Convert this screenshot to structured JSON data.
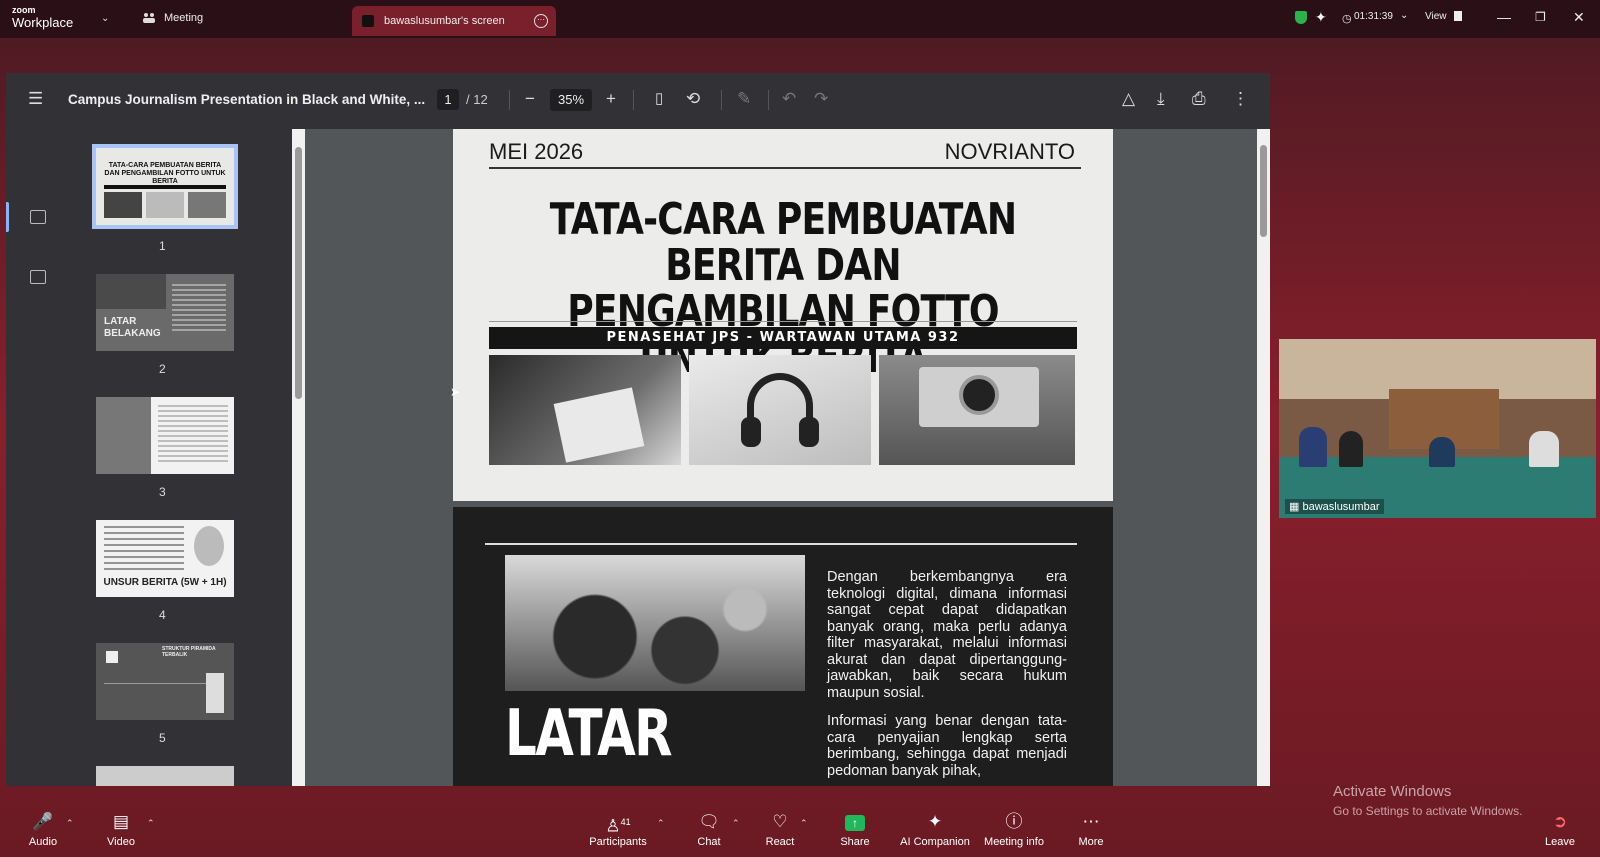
{
  "app": {
    "brand_top": "zoom",
    "brand_bottom": "Workplace"
  },
  "tabs": [
    {
      "label": "Meeting"
    },
    {
      "label": "bawaslusumbar's screen"
    }
  ],
  "topright": {
    "timer": "01:31:39",
    "view_label": "View"
  },
  "pdf": {
    "title": "Campus Journalism Presentation in Black and White, ...",
    "current_page": "1",
    "total_pages": "/ 12",
    "zoom": "35%"
  },
  "thumbnails": [
    {
      "num": "1",
      "title": "TATA-CARA PEMBUATAN BERITA DAN PENGAMBILAN FOTTO UNTUK BERITA"
    },
    {
      "num": "2",
      "title": "LATAR BELAKANG"
    },
    {
      "num": "3",
      "title": ""
    },
    {
      "num": "4",
      "title": "UNSUR BERITA (5W + 1H)"
    },
    {
      "num": "5",
      "title": "STRUKTUR PIRAMIDA TERBALIK"
    }
  ],
  "slide1": {
    "date": "MEI 2026",
    "author": "NOVRIANTO",
    "title_line1": "TATA-CARA PEMBUATAN BERITA DAN",
    "title_line2": "PENGAMBILAN FOTTO UNTUK BERITA",
    "band": "PENASEHAT JPS - WARTAWAN UTAMA 932"
  },
  "slide2": {
    "heading": "LATAR",
    "para1": "Dengan berkembangnya era teknologi digital, dimana informasi sangat cepat dapat didapatkan banyak orang, maka perlu adanya filter masyarakat, melalui informasi akurat dan dapat dipertanggung-jawabkan, baik secara hukum maupun sosial.",
    "para2": "Informasi yang benar dengan tata-cara penyajian lengkap serta berimbang, sehingga dapat menjadi pedoman banyak pihak,"
  },
  "video": {
    "participant_name": "bawaslusumbar"
  },
  "watermark": {
    "line1": "Activate Windows",
    "line2": "Go to Settings to activate Windows."
  },
  "bottombar": {
    "audio": "Audio",
    "video": "Video",
    "participants": "Participants",
    "participants_count": "41",
    "chat": "Chat",
    "react": "React",
    "share": "Share",
    "ai": "AI Companion",
    "info": "Meeting info",
    "more": "More",
    "leave": "Leave"
  },
  "colors": {
    "accent_share": "#1fb85a",
    "top_bar": "#2b0f17",
    "screen_tab": "#7a1f2c"
  }
}
